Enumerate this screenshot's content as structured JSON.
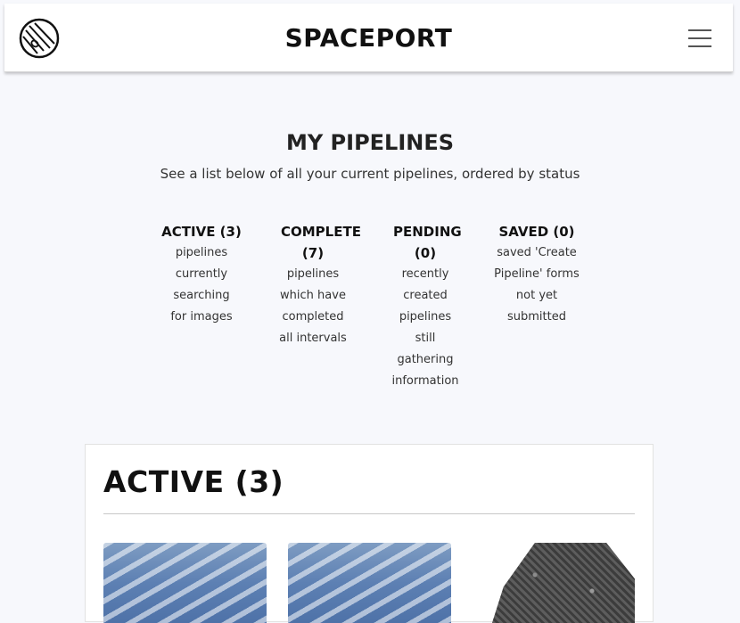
{
  "header": {
    "brand": "SPACEPORT",
    "logo_icon": "planet-logo-icon",
    "menu_icon": "hamburger-menu-icon"
  },
  "page": {
    "title": "MY PIPELINES",
    "subtitle": "See a list below of all your current pipelines, ordered by status"
  },
  "statuses": [
    {
      "heading": "ACTIVE (3)",
      "description": "pipelines currently searching for images"
    },
    {
      "heading": "COMPLETE (7)",
      "description": "pipelines which have completed all intervals"
    },
    {
      "heading": "PENDING (0)",
      "description": "recently created pipelines still gathering information"
    },
    {
      "heading": "SAVED (0)",
      "description": "saved 'Create Pipeline' forms not yet submitted"
    }
  ],
  "active_section": {
    "title": "ACTIVE (3)",
    "thumbnails": [
      "sky-image",
      "sky-image",
      "rock-image"
    ]
  }
}
